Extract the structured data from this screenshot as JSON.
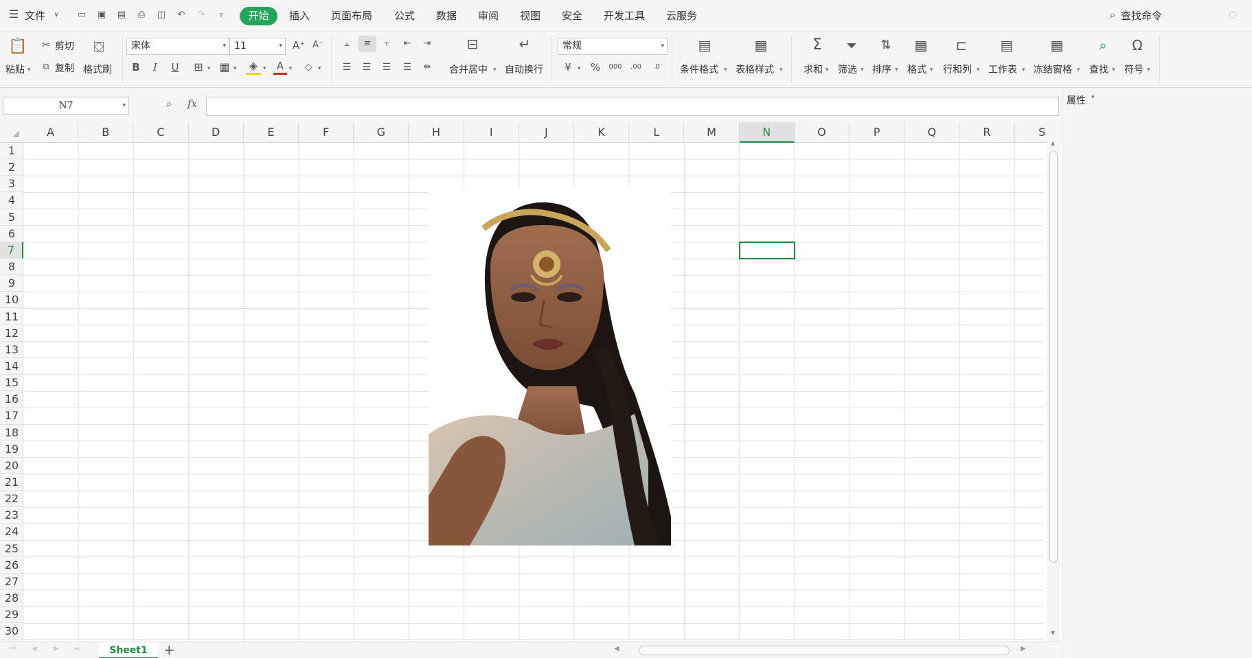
{
  "menubar": {
    "file_label": "文件",
    "tabs": [
      "开始",
      "插入",
      "页面布局",
      "公式",
      "数据",
      "审阅",
      "视图",
      "安全",
      "开发工具",
      "云服务"
    ],
    "active_tab": "开始",
    "search_label": "查找命令"
  },
  "ribbon": {
    "paste_label": "粘贴",
    "cut_label": "剪切",
    "copy_label": "复制",
    "format_painter_label": "格式刷",
    "font_name": "宋体",
    "font_size": "11",
    "bold": "B",
    "italic": "I",
    "underline": "U",
    "merge_center_label": "合并居中",
    "wrap_text_label": "自动换行",
    "number_format": "常规",
    "percent_label": "%",
    "conditional_format_label": "条件格式",
    "table_style_label": "表格样式",
    "sum_label": "求和",
    "filter_label": "筛选",
    "sort_label": "排序",
    "format_label": "格式",
    "row_col_label": "行和列",
    "worksheet_label": "工作表",
    "freeze_label": "冻结窗格",
    "find_label": "查找",
    "symbol_label": "符号"
  },
  "formula_bar": {
    "name_box": "N7",
    "fx_label": "fx",
    "formula_value": ""
  },
  "side_panel": {
    "title": "属性"
  },
  "sheet": {
    "columns": [
      "A",
      "B",
      "C",
      "D",
      "E",
      "F",
      "G",
      "H",
      "I",
      "J",
      "K",
      "L",
      "M",
      "N",
      "O",
      "P",
      "Q",
      "R",
      "S"
    ],
    "rows": [
      "1",
      "2",
      "3",
      "4",
      "5",
      "6",
      "7",
      "8",
      "9",
      "10",
      "11",
      "12",
      "13",
      "14",
      "15",
      "16",
      "17",
      "18",
      "19",
      "20",
      "21",
      "22",
      "23",
      "24",
      "25",
      "26",
      "27",
      "28",
      "29",
      "30"
    ],
    "selected_cell": "N7",
    "selected_column": "N",
    "selected_row": "7"
  },
  "sheet_tabs": {
    "tabs": [
      "Sheet1"
    ],
    "add_label": "+"
  },
  "colors": {
    "accent": "#25a55a",
    "selection": "#1e8a3f"
  }
}
